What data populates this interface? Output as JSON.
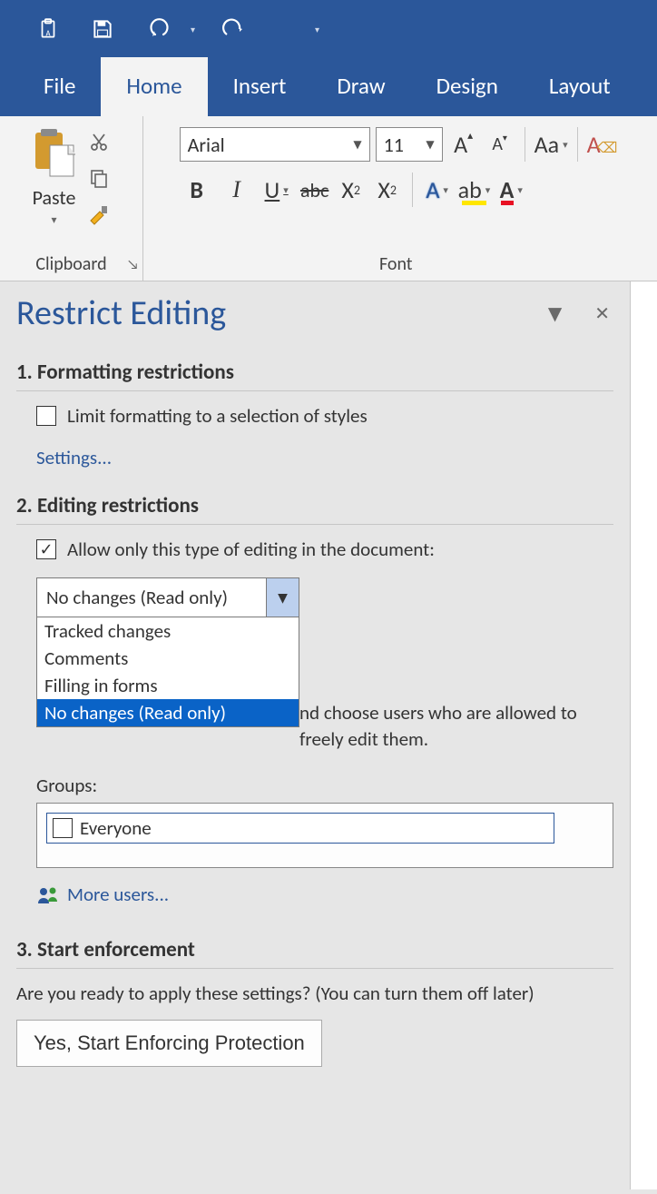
{
  "tabs": {
    "file": "File",
    "home": "Home",
    "insert": "Insert",
    "draw": "Draw",
    "design": "Design",
    "layout": "Layout"
  },
  "ribbon": {
    "paste_label": "Paste",
    "clipboard_label": "Clipboard",
    "font_label": "Font",
    "font_name": "Arial",
    "font_size": "11",
    "case_label": "Aa"
  },
  "pane": {
    "title": "Restrict Editing",
    "h1": "1. Formatting restrictions",
    "limit_fmt": "Limit formatting to a selection of styles",
    "settings_link": "Settings...",
    "h2": "2. Editing restrictions",
    "allow_only": "Allow only this type of editing in the document:",
    "select_value": "No changes (Read only)",
    "options": {
      "tracked": "Tracked changes",
      "comments": "Comments",
      "forms": "Filling in forms",
      "readonly": "No changes (Read only)"
    },
    "exceptions_tail": "nd choose users who are allowed to freely edit them.",
    "groups_label": "Groups:",
    "everyone": "Everyone",
    "more_users": "More users...",
    "h3": "3. Start enforcement",
    "enforce_q": "Are you ready to apply these settings? (You can turn them off later)",
    "enforce_btn": "Yes, Start Enforcing Protection"
  }
}
